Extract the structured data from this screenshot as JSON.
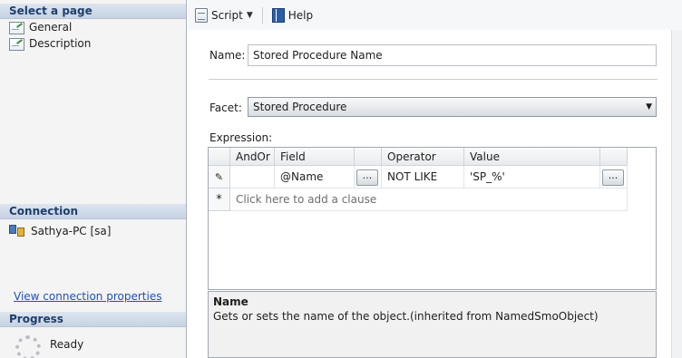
{
  "sidebar": {
    "select_page_header": "Select a page",
    "pages": [
      {
        "label": "General",
        "icon": "properties-page-icon"
      },
      {
        "label": "Description",
        "icon": "properties-page-icon"
      }
    ],
    "connection_header": "Connection",
    "connection_label": "Sathya-PC [sa]",
    "view_connection_link": "View connection properties",
    "progress_header": "Progress",
    "progress_status": "Ready"
  },
  "toolbar": {
    "script_label": "Script",
    "help_label": "Help"
  },
  "form": {
    "name_label": "Name:",
    "name_value": "Stored Procedure Name",
    "facet_label": "Facet:",
    "facet_value": "Stored Procedure",
    "expression_label": "Expression:"
  },
  "grid": {
    "columns": [
      "AndOr",
      "Field",
      "Operator",
      "Value"
    ],
    "rows": [
      {
        "marker": "pencil",
        "andor": "",
        "field": "@Name",
        "operator": "NOT LIKE",
        "value": "'SP_%'"
      }
    ],
    "ellipsis_label": "...",
    "add_clause_text": "Click here to add a clause",
    "new_row_marker": "*"
  },
  "description": {
    "title": "Name",
    "text": "Gets or sets the name of the object.(inherited from NamedSmoObject)"
  }
}
